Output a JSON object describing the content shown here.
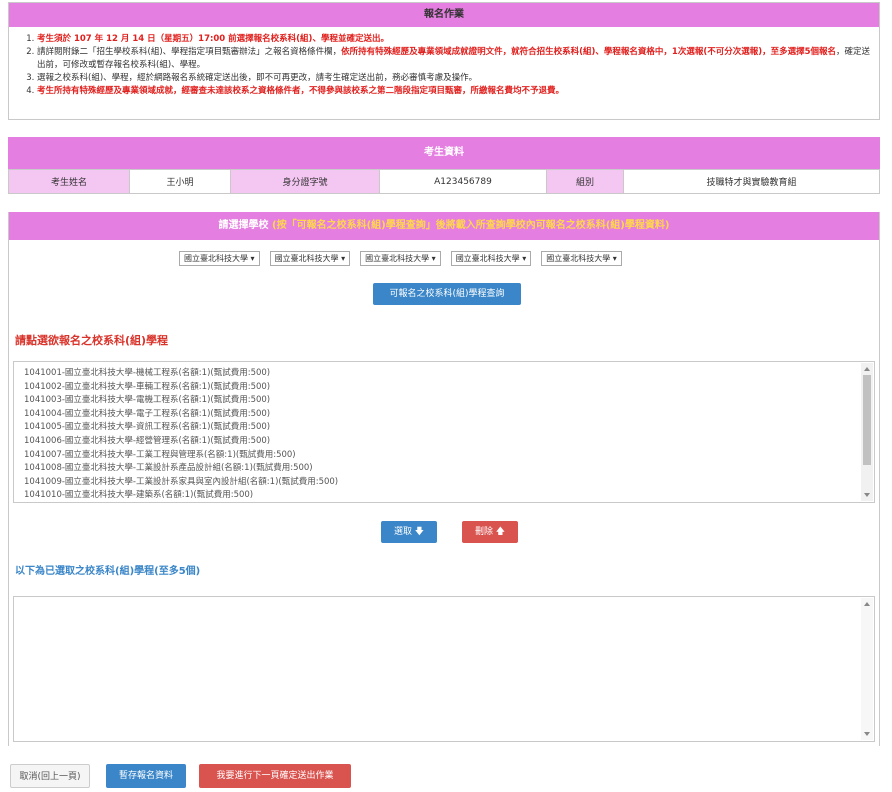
{
  "notice": {
    "title": "報名作業",
    "items": [
      {
        "parts": [
          {
            "t": "考生須於 107 年 12 月 14 日（星期五）17:00 前選擇報名校系科(組)、學程並確定送出。",
            "red": true
          }
        ]
      },
      {
        "parts": [
          {
            "t": "請詳閱附錄二「招生學校系科(組)、學程指定項目甄審辦法」之報名資格條件欄，",
            "red": false
          },
          {
            "t": "依所持有特殊經歷及專業領域成就證明文件，就符合招生校系科(組)、學程報名資格中，1次選報(不可分次選報)，至多選擇5個報名",
            "red": true
          },
          {
            "t": "，確定送出前，可修改或暫存報名校系科(組)、學程。",
            "red": false
          }
        ]
      },
      {
        "parts": [
          {
            "t": "選報之校系科(組)、學程，經於網路報名系統確定送出後，即不可再更改，請考生確定送出前，務必審慎考慮及操作。",
            "red": false
          }
        ]
      },
      {
        "parts": [
          {
            "t": "考生所持有特殊經歷及專業領域成就，經審查未達該校系之資格條件者，不得參與該校系之第二階段指定項目甄審，所繳報名費均不予退費。",
            "red": true
          }
        ]
      }
    ]
  },
  "candidate": {
    "title": "考生資料",
    "name_label": "考生姓名",
    "name_value": "王小明",
    "id_label": "身分證字號",
    "id_value": "A123456789",
    "group_label": "組別",
    "group_value": "技職特才與實驗教育組"
  },
  "school_select": {
    "title": "請選擇學校",
    "hint": "(按「可報名之校系科(組)學程查詢」後將載入所查詢學校內可報名之校系科(組)學程資料)",
    "selects": [
      "國立臺北科技大學",
      "國立臺北科技大學",
      "國立臺北科技大學",
      "國立臺北科技大學",
      "國立臺北科技大學"
    ],
    "query_button": "可報名之校系科(組)學程查詢"
  },
  "programs": {
    "title": "請點選欲報名之校系科(組)學程",
    "items": [
      "1041001-國立臺北科技大學-機械工程系(名額:1)(甄試費用:500)",
      "1041002-國立臺北科技大學-車輛工程系(名額:1)(甄試費用:500)",
      "1041003-國立臺北科技大學-電機工程系(名額:1)(甄試費用:500)",
      "1041004-國立臺北科技大學-電子工程系(名額:1)(甄試費用:500)",
      "1041005-國立臺北科技大學-資訊工程系(名額:1)(甄試費用:500)",
      "1041006-國立臺北科技大學-經營管理系(名額:1)(甄試費用:500)",
      "1041007-國立臺北科技大學-工業工程與管理系(名額:1)(甄試費用:500)",
      "1041008-國立臺北科技大學-工業設計系產品設計組(名額:1)(甄試費用:500)",
      "1041009-國立臺北科技大學-工業設計系家具與室內設計組(名額:1)(甄試費用:500)",
      "1041010-國立臺北科技大學-建築系(名額:1)(甄試費用:500)"
    ],
    "pick_button": "選取 🡇",
    "delete_button": "刪除 🡅"
  },
  "selected": {
    "title": "以下為已選取之校系科(組)學程(至多5個)"
  },
  "footer": {
    "cancel": "取消(回上一頁)",
    "save": "暫存報名資料",
    "next": "我要進行下一頁確定送出作業"
  }
}
